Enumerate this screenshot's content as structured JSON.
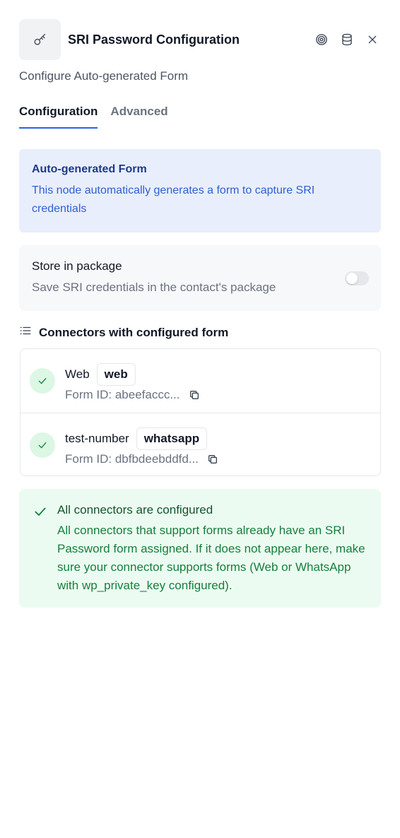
{
  "header": {
    "title": "SRI Password Configuration",
    "subtitle": "Configure Auto-generated Form",
    "node_icon": "key-icon",
    "actions": [
      "target-icon",
      "database-icon",
      "close-icon"
    ]
  },
  "tabs": [
    {
      "label": "Configuration",
      "active": true
    },
    {
      "label": "Advanced",
      "active": false
    }
  ],
  "info": {
    "title": "Auto-generated Form",
    "text": "This node automatically generates a form to capture SRI credentials"
  },
  "store": {
    "title": "Store in package",
    "subtitle": "Save SRI credentials in the contact's package",
    "enabled": false
  },
  "connectors": {
    "title": "Connectors with configured form",
    "items": [
      {
        "name": "Web",
        "type": "web",
        "form_id": "Form ID: abeefaccc..."
      },
      {
        "name": "test-number",
        "type": "whatsapp",
        "form_id": "Form ID: dbfbdeebddfd..."
      }
    ]
  },
  "success": {
    "title": "All connectors are configured",
    "text": "All connectors that support forms already have an SRI Password form assigned. If it does not appear here, make sure your connector supports forms (Web or WhatsApp with wp_private_key configured)."
  },
  "colors": {
    "accent": "#2563eb",
    "info_bg": "#e9eefc",
    "success_bg": "#ecfbf1",
    "success_text": "#15803d"
  }
}
